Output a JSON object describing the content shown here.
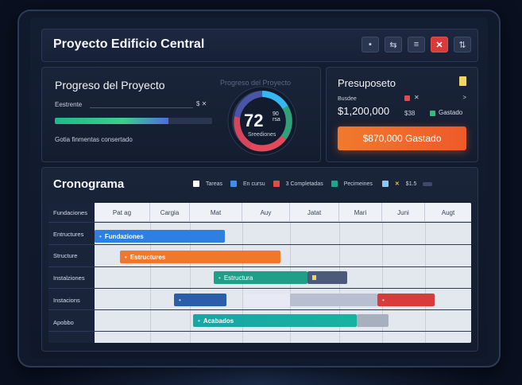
{
  "window": {
    "title": "Proyecto Edificio Central",
    "buttons": [
      "▪",
      "⇆",
      "≡",
      "✕",
      "⇅"
    ]
  },
  "progress": {
    "heading": "Progreso del Proyecto",
    "ghost_heading": "Progreso del Proyecto",
    "field_label": "Eestrente",
    "field_icons": "$ ✕",
    "bar_fraction": 0.72,
    "footer": "Gotia finmentas consertado",
    "gauge_value": "72",
    "gauge_unit_top": "90",
    "gauge_unit_bottom": "rsa",
    "gauge_subtitle": "Sreediones"
  },
  "budget": {
    "heading": "Presuposeto",
    "label": "Busdee",
    "value": "$1,200,000",
    "chevron": ">",
    "code": "$38",
    "spent_label": "Gastado",
    "spent_button": "$870,000 Gastado"
  },
  "schedule": {
    "heading": "Cronograma",
    "legend": [
      {
        "label": "Tareas",
        "color": "#ffffff"
      },
      {
        "label": "En cursu",
        "color": "#3b8ff0"
      },
      {
        "label": "3 Completadas",
        "color": "#e24b4b"
      },
      {
        "label": "Pecimeines",
        "color": "#1fa58a"
      }
    ],
    "legend_extra": "$1.5",
    "rows": [
      "Fundaciones",
      "Entructures",
      "Structure",
      "Instalziones",
      "Instacions",
      "Apobbo"
    ],
    "months": [
      "Pat   ag",
      "Cargia",
      "Mat",
      "Auy",
      "Jatat",
      "Mari",
      "Juni",
      "Augt"
    ],
    "bars": [
      {
        "label": "Fundaziones",
        "color": "#2f7fe0"
      },
      {
        "label": "Estructures",
        "color": "#f0782c"
      },
      {
        "label": "Estructura",
        "color": "#1f9e88"
      },
      {
        "label": "",
        "color": "#2a5ea8"
      },
      {
        "label": "Acabados",
        "color": "#1aa5a5"
      }
    ]
  }
}
